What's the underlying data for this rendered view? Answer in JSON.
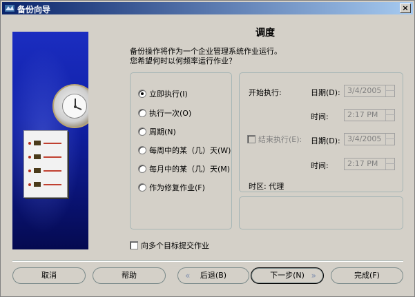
{
  "window": {
    "title": "备份向导"
  },
  "section_title": "调度",
  "intro": {
    "line1": "备份操作将作为一个企业管理系统作业运行。",
    "line2": "您希望何时以何频率运行作业？"
  },
  "schedule_options": [
    {
      "label": "立即执行(I)",
      "checked": true
    },
    {
      "label": "执行一次(O)",
      "checked": false
    },
    {
      "label": "周期(N)",
      "checked": false
    },
    {
      "label": "每周中的某（几）天(W)",
      "checked": false
    },
    {
      "label": "每月中的某（几）天(M)",
      "checked": false
    },
    {
      "label": "作为修复作业(F)",
      "checked": false
    }
  ],
  "start": {
    "label": "开始执行:",
    "date_label": "日期(D):",
    "date_value": "3/4/2005",
    "time_label": "时间:",
    "time_value": "2:17 PM"
  },
  "end": {
    "label": "结束执行(E):",
    "date_label": "日期(D):",
    "date_value": "3/4/2005",
    "time_label": "时间:",
    "time_value": "2:17 PM"
  },
  "timezone": "时区: 代理",
  "multi_target": "向多个目标提交作业",
  "buttons": {
    "cancel": "取消",
    "help": "帮助",
    "back": "后退(B)",
    "next": "下一步(N)",
    "finish": "完成(F)"
  },
  "icons": [
    "wizard-app-icon",
    "close-icon",
    "clock-illustration-icon",
    "document-illustration-icon",
    "arrow-left-icon",
    "arrow-right-icon"
  ]
}
